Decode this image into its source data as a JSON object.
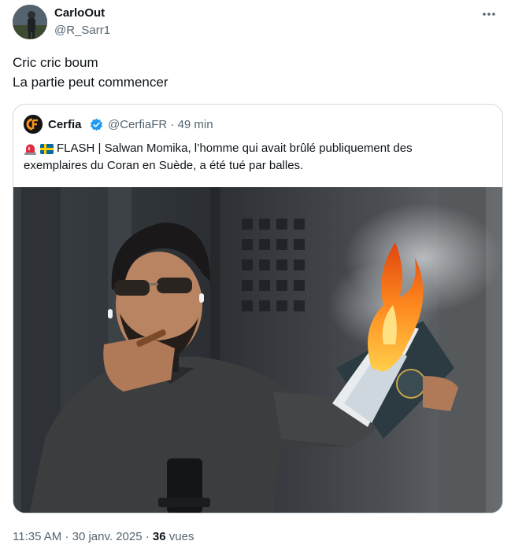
{
  "author": {
    "name": "CarloOut",
    "handle": "@R_Sarr1"
  },
  "tweet": {
    "lines": [
      "Cric cric boum",
      "La partie peut commencer"
    ]
  },
  "quote": {
    "name": "Cerfia",
    "handle": "@CerfiaFR",
    "separator": "·",
    "time": "49 min",
    "text_line1": "FLASH | Salwan Momika, l’homme qui avait brûlé publiquement des",
    "text_line2": "exemplaires du Coran en Suède, a été tué par balles."
  },
  "meta": {
    "time": "11:35 AM",
    "separator": "·",
    "date": "30 janv. 2025",
    "views_count": "36",
    "views_label": "vues"
  },
  "icons": {
    "more": "more-horizontal-icon",
    "verified": "verified-badge-icon",
    "siren": "police-light-emoji",
    "flag": "sweden-flag-emoji"
  },
  "colors": {
    "text_primary": "#0f1419",
    "text_secondary": "#536471",
    "border": "#cfd9de",
    "verified_blue": "#1d9bf0"
  }
}
